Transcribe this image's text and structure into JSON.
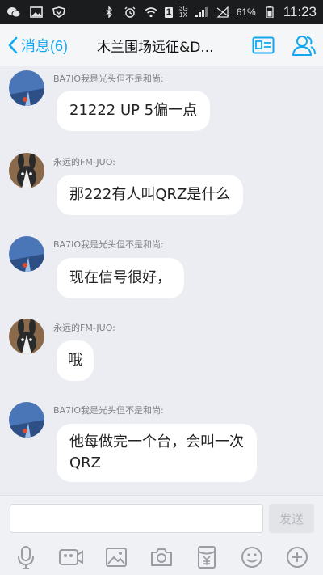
{
  "status_bar": {
    "icons": [
      "wechat-icon",
      "image-icon",
      "shield-icon",
      "bluetooth-icon",
      "alarm-icon",
      "wifi-icon"
    ],
    "sim_slot": "1",
    "net_type_top": "3G",
    "net_type_bottom": "1X",
    "battery_percent": "61%",
    "time": "11:23"
  },
  "nav": {
    "back_label": "消息(6)",
    "title": "木兰围场远征&D...",
    "accent_color": "#12a8f0"
  },
  "messages": [
    {
      "sender": "BA7IO我是光头但不是和尚:",
      "text": "21222 UP 5偏一点",
      "avatar": "sky-avatar"
    },
    {
      "sender": "永远的FM-JUO:",
      "text": "那222有人叫QRZ是什么",
      "avatar": "rabbit-avatar"
    },
    {
      "sender": "BA7IO我是光头但不是和尚:",
      "text": "现在信号很好，",
      "avatar": "sky-avatar"
    },
    {
      "sender": "永远的FM-JUO:",
      "text": "哦",
      "avatar": "rabbit-avatar"
    },
    {
      "sender": "BA7IO我是光头但不是和尚:",
      "text_line1": "他每做完一个台，会叫一次",
      "text_line2": "QRZ",
      "avatar": "sky-avatar"
    }
  ],
  "input": {
    "value": "",
    "send_label": "发送"
  },
  "toolbar": {
    "items": [
      "microphone-icon",
      "video-icon",
      "picture-icon",
      "camera-icon",
      "red-packet-icon",
      "emoji-icon",
      "plus-icon"
    ]
  }
}
